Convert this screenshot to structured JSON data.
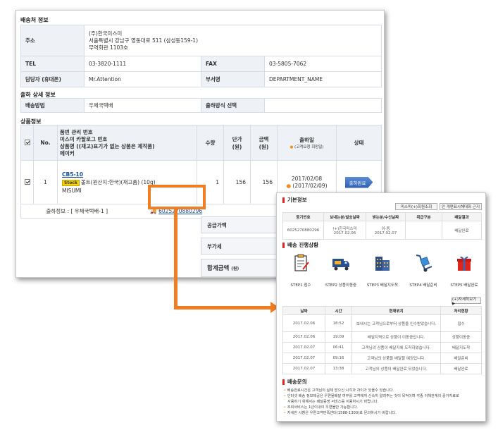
{
  "back": {
    "shipping_info_title": "배송처 정보",
    "address_label": "주소",
    "address_lines": [
      "(주)한국미스미",
      "서울특별시 강남구 영동대로 511 (삼성동159-1)",
      "무역회관 1103호"
    ],
    "tel_label": "TEL",
    "tel_value": "03-3820-1111",
    "fax_label": "FAX",
    "fax_value": "03-5805-7062",
    "contact_label": "담당자 (휴대폰)",
    "contact_value": "Mr.Attention",
    "dept_label": "부서명",
    "dept_value": "DEPARTMENT_NAME",
    "shipment_detail_title": "출하 상세 정보",
    "delivery_method_label": "배송방법",
    "delivery_method_value": "우체국택배",
    "ship_option_label": "출하방식 선택",
    "ship_option_value": "",
    "product_info_title": "상품정보",
    "table_headers": {
      "no": "No.",
      "product_lines": [
        "품번 관리 번호",
        "미스미 카탈로그 번호",
        "상품명 ((재고)표기가 없는 상품은 제작품)",
        "메이커"
      ],
      "qty": "수량",
      "unit_price_lines": [
        "단가",
        "(원)"
      ],
      "amount_lines": [
        "금액",
        "(원)"
      ],
      "ship_date": "출하일",
      "ship_date_note": "(고객요청 희망일)",
      "status": "상태"
    },
    "row": {
      "no": "1",
      "part_link": "CB5-10",
      "stock_badge": "Stock",
      "product_name": "볼트(원산지:한국)(재고품)  (10g)",
      "maker": "MISUMI",
      "qty": "1",
      "unit_price": "156",
      "amount": "156",
      "ship_date": "2017/02/08",
      "requested_date": "(2017/02/09)",
      "status": "출하완료",
      "ship_info": "출하정보 : [ 우체국택배-1 ]",
      "tracking_number": "6025270880296"
    },
    "supply_price_label": "공급가액",
    "vat_label": "부가세",
    "total_label": "합계금액",
    "total_unit": "(원)"
  },
  "front": {
    "basic_info_title": "기본정보",
    "btn_misumi": "미스미(+)회원조회",
    "btn_print": "인 개편표시해대화 근지",
    "info_headers": [
      "등기번호",
      "보내는분/발송날짜",
      "받는분/수신날짜",
      "취급구분",
      "배달결과"
    ],
    "info_row": [
      "6025270880296",
      "(+)한국미스미\n2017.02.06",
      "이-동\n2017.02.07",
      "",
      "배달완료"
    ],
    "progress_title": "배송 진행상황",
    "steps": [
      "STEP1 접수",
      "STEP2 상품이동중",
      "STEP3 배달지도착",
      "STEP4 배달준비",
      "STEP5 배달완료"
    ],
    "detail_btn": "(+)자세히보기 ▶",
    "track_headers": [
      "날짜",
      "시간",
      "현재위치",
      "처리현황"
    ],
    "track_rows": [
      [
        "2017.02.06",
        "18:52",
        "보내시는 고객님으로부터 상품을 인수받았습니다.",
        "접수"
      ],
      [
        "2017.02.06",
        "19:09",
        "배달지역으로 상품이 이동중입니다.",
        "상품이동중"
      ],
      [
        "2017.02.07",
        "06:41",
        "고객님의 상품이 배달지에 도착하였습니다.",
        "배달지도착"
      ],
      [
        "2017.02.07",
        "09:16",
        "고객님의 상품을 배달할 예정입니다.",
        "배달준비"
      ],
      [
        "2017.02.07",
        "13:38",
        "고객님의 상품이 배달완료 되었습니다.",
        "배달완료"
      ]
    ],
    "inquiry_title": "배송문의",
    "notes": [
      "배송완료시간은 고객님의 실제 받으신 시각과 차이가 있을수 있습니다.",
      "인터넷 배송 정보제공은 우편물배달 여부를 고객에게 신속히 알려주는 것이 목적이며 각종 이해관계의 증거자료로",
      "사용하기 위해서는 배달증명 서비스를 이용하시기 바랍니다.",
      "조회서비스는 1년이내의 우편물만 가능합니다.",
      "자세한 사항은 우편고객만족센터(1588-1300)로 문의하시기 바랍니다."
    ],
    "notes_bulleted": [
      true,
      true,
      false,
      true,
      true
    ]
  }
}
